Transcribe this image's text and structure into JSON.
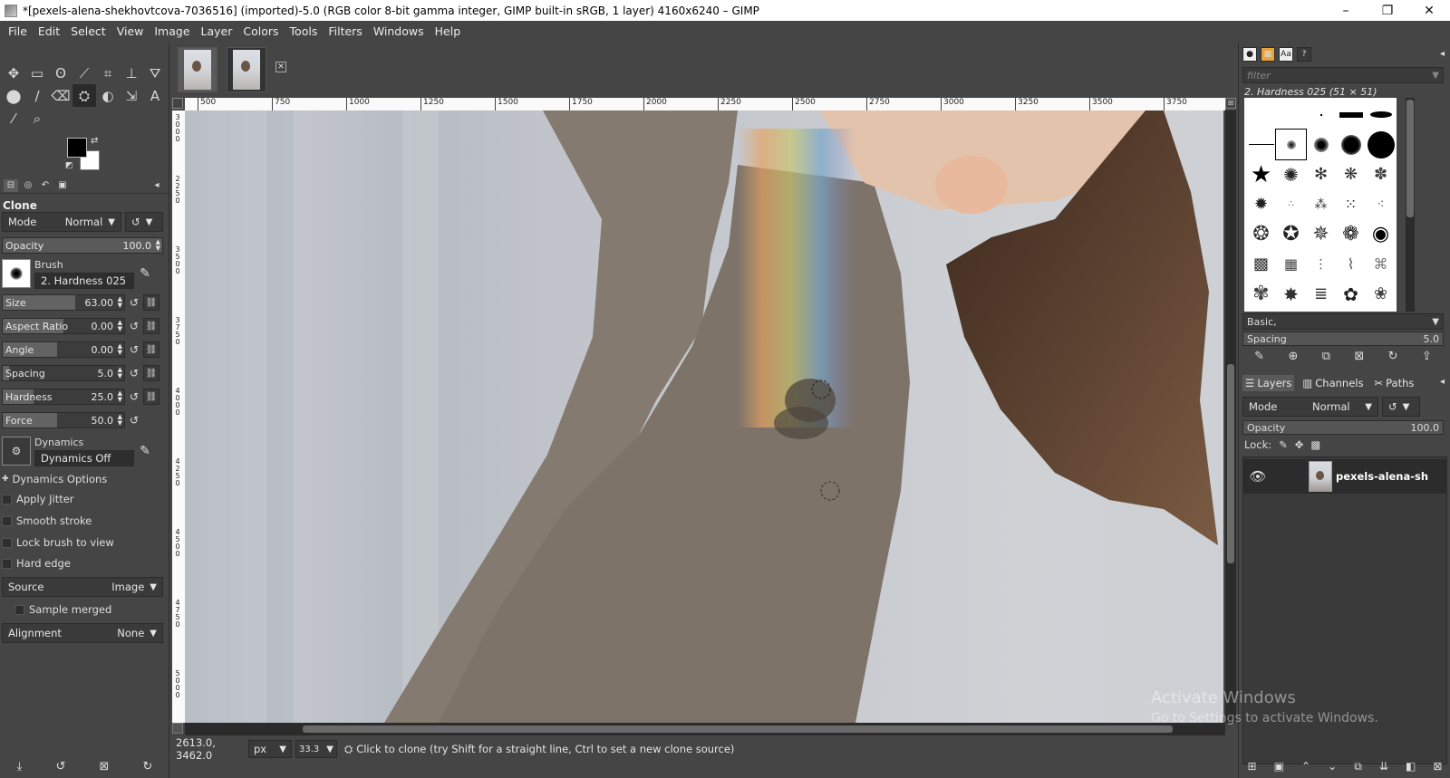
{
  "window": {
    "title": "*[pexels-alena-shekhovtcova-7036516] (imported)-5.0 (RGB color 8-bit gamma integer, GIMP built-in sRGB, 1 layer) 4160x6240 – GIMP",
    "min": "–",
    "max": "❐",
    "close": "✕"
  },
  "menu": [
    "File",
    "Edit",
    "Select",
    "View",
    "Image",
    "Layer",
    "Colors",
    "Tools",
    "Filters",
    "Windows",
    "Help"
  ],
  "tools": [
    "✥",
    "▭",
    "ʘ",
    "⟋",
    "⌗",
    "⊥",
    "⛛",
    "⬤",
    "∕",
    "⌫",
    "⛭",
    "◐",
    "⇲",
    "A",
    "⁄",
    "⌕"
  ],
  "tool_options": {
    "title": "Clone",
    "mode_label": "Mode",
    "mode_value": "Normal",
    "opacity_label": "Opacity",
    "opacity_value": "100.0",
    "brush_label": "Brush",
    "brush_value": "2. Hardness 025",
    "sliders": [
      {
        "label": "Size",
        "value": "63.00",
        "fill": 0.6
      },
      {
        "label": "Aspect Ratio",
        "value": "0.00",
        "fill": 0.5
      },
      {
        "label": "Angle",
        "value": "0.00",
        "fill": 0.45
      },
      {
        "label": "Spacing",
        "value": "5.0",
        "fill": 0.05
      },
      {
        "label": "Hardness",
        "value": "25.0",
        "fill": 0.25
      },
      {
        "label": "Force",
        "value": "50.0",
        "fill": 0.45
      }
    ],
    "dynamics_label": "Dynamics",
    "dynamics_value": "Dynamics Off",
    "dynamics_options": "Dynamics Options",
    "checks": [
      "Apply Jitter",
      "Smooth stroke",
      "Lock brush to view",
      "Hard edge"
    ],
    "source_label": "Source",
    "source_value": "Image",
    "sample_merged": "Sample merged",
    "alignment_label": "Alignment",
    "alignment_value": "None"
  },
  "ruler": {
    "h": [
      "500",
      "750",
      "1000",
      "1250",
      "1500",
      "1750",
      "2000",
      "2250",
      "2500",
      "2750",
      "3000",
      "3250",
      "3500",
      "3750"
    ],
    "v": [
      "3000",
      "2250",
      "3500",
      "3750",
      "4000",
      "4250",
      "4500",
      "4750",
      "5000"
    ]
  },
  "status": {
    "coords": "2613.0, 3462.0",
    "unit": "px",
    "zoom": "33.3",
    "message": "Click to clone (try Shift for a straight line, Ctrl to set a new clone source)"
  },
  "brushes": {
    "filter_placeholder": "filter",
    "selected_name": "2. Hardness 025 (51 × 51)",
    "preset": "Basic,",
    "spacing_label": "Spacing",
    "spacing_value": "5.0"
  },
  "layers": {
    "tabs": [
      "Layers",
      "Channels",
      "Paths"
    ],
    "mode_label": "Mode",
    "mode_value": "Normal",
    "opacity_label": "Opacity",
    "opacity_value": "100.0",
    "lock_label": "Lock:",
    "layer_name": "pexels-alena-sh"
  },
  "watermark": {
    "line1": "Activate Windows",
    "line2": "Go to Settings to activate Windows."
  }
}
